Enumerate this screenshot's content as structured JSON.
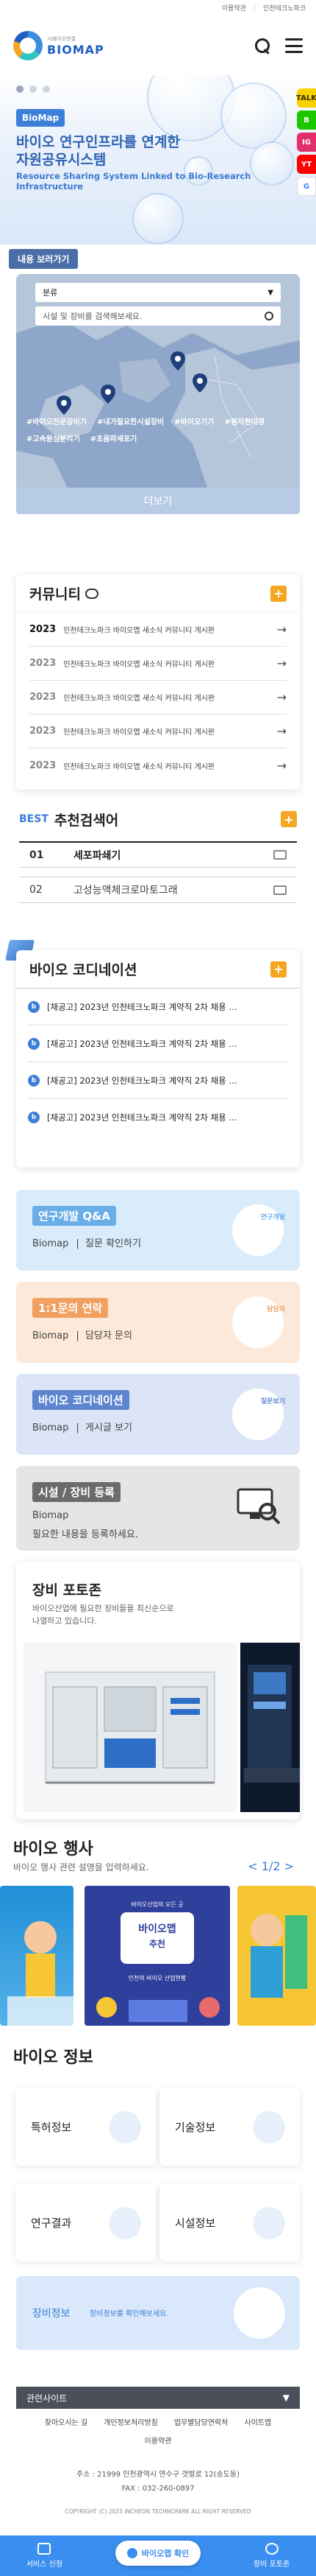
{
  "topbar": {
    "link1": "이용약관",
    "link2": "인천테크노파크"
  },
  "header": {
    "logo_sub": "시에이오연결",
    "logo_main": "BIOMAP"
  },
  "hero": {
    "badge": "BioMap",
    "title_line1": "바이오 연구인프라를 연계한",
    "title_line2": "자원공유시스템",
    "subtitle": "Resource Sharing System Linked to Bio-Research Infrastructure"
  },
  "side_social": [
    "TALK",
    "B",
    "IG",
    "YT",
    "G"
  ],
  "map": {
    "label": "내용 보러가기",
    "select": "분류",
    "search_placeholder": "시설 및 장비를 검색해보세요.",
    "tags": [
      "#바이오전문장비기",
      "#내가필요한시설장비",
      "#바이오기기",
      "#원자현미경",
      "#고속원심분리기",
      "#초음파세포기"
    ],
    "more": "더보기"
  },
  "community": {
    "title": "커뮤니티",
    "rows": [
      {
        "year": "2023",
        "text": "인천테크노파크 바이오맵 새소식 커뮤니티 게시판"
      },
      {
        "year": "2023",
        "text": "인천테크노파크 바이오맵 새소식 커뮤니티 게시판"
      },
      {
        "year": "2023",
        "text": "인천테크노파크 바이오맵 새소식 커뮤니티 게시판"
      },
      {
        "year": "2023",
        "text": "인천테크노파크 바이오맵 새소식 커뮤니티 게시판"
      },
      {
        "year": "2023",
        "text": "인천테크노파크 바이오맵 새소식 커뮤니티 게시판"
      }
    ]
  },
  "best": {
    "badge": "BEST",
    "title": "추천검색어",
    "items": [
      {
        "num": "01",
        "text": "세포파쇄기"
      },
      {
        "num": "02",
        "text": "고성능액체크로마토그래"
      }
    ]
  },
  "coordinator": {
    "title": "바이오 코디네이션",
    "rows": [
      "[채공고] 2023년 인천테크노파크 계약직 2차 채용 …",
      "[채공고] 2023년 인천테크노파크 계약직 2차 채용 …",
      "[채공고] 2023년 인천테크노파크 계약직 2차 채용 …",
      "[채공고] 2023년 인천테크노파크 계약직 2차 채용 …"
    ]
  },
  "features": [
    {
      "title": "연구개발 Q&A",
      "brand": "Biomap",
      "desc": "질문 확인하기",
      "tag": "연구개발",
      "bg": "#d9ecfb",
      "accent": "#6aaee8"
    },
    {
      "title": "1:1문의 연락",
      "brand": "Biomap",
      "desc": "담당자 문의",
      "tag": "담당자",
      "bg": "#fde9d9",
      "accent": "#f0a060"
    },
    {
      "title": "바이오 코디네이션",
      "brand": "Biomap",
      "desc": "게시글 보기",
      "tag": "질문보기",
      "bg": "#dbe5f7",
      "accent": "#5d86cf"
    },
    {
      "title": "시설 / 장비 등록",
      "brand": "Biomap",
      "desc": "필요한 내용을 등록하세요.",
      "tag": "",
      "bg": "#e5e5e5",
      "accent": "#6b6b6b"
    }
  ],
  "equip": {
    "title": "장비 포토존",
    "desc_line1": "바이오산업에 필요한 장비들을 최신순으로",
    "desc_line2": "나열하고 있습니다."
  },
  "events": {
    "title": "바이오 행사",
    "desc": "바이오 행사 관련 설명을 입력하세요.",
    "pager": "< 1/2 >",
    "banner_small": "바이오산업의 모든 곳",
    "banner_main": "바이오맵",
    "banner_sub": "추천",
    "banner_foot": "인천의 바이오 산업현황"
  },
  "info": {
    "title": "바이오 정보",
    "cards": [
      "특허정보",
      "기술정보",
      "연구결과",
      "시설정보"
    ],
    "banner_label": "장비정보",
    "banner_desc": "장비정보를 확인해보세요."
  },
  "footer": {
    "select": "관련사이트",
    "links": [
      "찾아오시는 길",
      "개인정보처리방침",
      "업무별담당연락처",
      "사이트맵",
      "이용약관"
    ],
    "address": "주소 : 21999 인천광역시 연수구 갯벌로 12(송도동)",
    "fax": "FAX : 032-260-0897",
    "copyright": "COPYRIGHT (C) 2023 INCHEON TECHNOPARK ALL RIGHT RESERVED"
  },
  "bottom_nav": {
    "left": "서비스 신청",
    "center": "바이오맵 확인",
    "right": "장비 포토존"
  }
}
